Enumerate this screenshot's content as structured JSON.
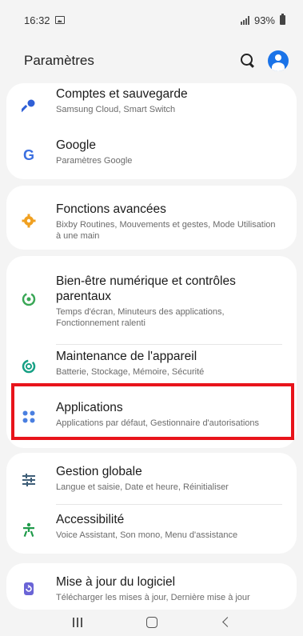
{
  "status_bar": {
    "time": "16:32",
    "battery": "93%"
  },
  "app_bar": {
    "title": "Paramètres"
  },
  "settings": [
    {
      "id": "comptes",
      "title": "Comptes et sauvegarde",
      "subtitle": "Samsung Cloud, Smart Switch",
      "icon": "key-icon",
      "color": "#2f5fd6"
    },
    {
      "id": "google",
      "title": "Google",
      "subtitle": "Paramètres Google",
      "icon": "google-icon",
      "color": "#3b6fe0"
    },
    {
      "id": "fonctions",
      "title": "Fonctions avancées",
      "subtitle": "Bixby Routines, Mouvements et gestes, Mode Utilisation à une main",
      "icon": "gear-icon",
      "color": "#f0a020"
    },
    {
      "id": "bienetre",
      "title": "Bien-être numérique et contrôles parentaux",
      "subtitle": "Temps d'écran, Minuteurs des applications, Fonctionnement ralenti",
      "icon": "digital-wellbeing-icon",
      "color": "#3aa756"
    },
    {
      "id": "maintenance",
      "title": "Maintenance de l'appareil",
      "subtitle": "Batterie, Stockage, Mémoire, Sécurité",
      "icon": "device-care-icon",
      "color": "#16a084"
    },
    {
      "id": "applications",
      "title": "Applications",
      "subtitle": "Applications par défaut, Gestionnaire d'autorisations",
      "icon": "apps-icon",
      "color": "#4a7fe0"
    },
    {
      "id": "gestion",
      "title": "Gestion globale",
      "subtitle": "Langue et saisie, Date et heure, Réinitialiser",
      "icon": "sliders-icon",
      "color": "#3e5e78"
    },
    {
      "id": "accessibilite",
      "title": "Accessibilité",
      "subtitle": "Voice Assistant, Son mono, Menu d'assistance",
      "icon": "accessibility-icon",
      "color": "#1f9a4a"
    },
    {
      "id": "majlogiciel",
      "title": "Mise à jour du logiciel",
      "subtitle": "Télécharger les mises à jour, Dernière mise à jour",
      "icon": "software-update-icon",
      "color": "#6a64d6"
    }
  ]
}
